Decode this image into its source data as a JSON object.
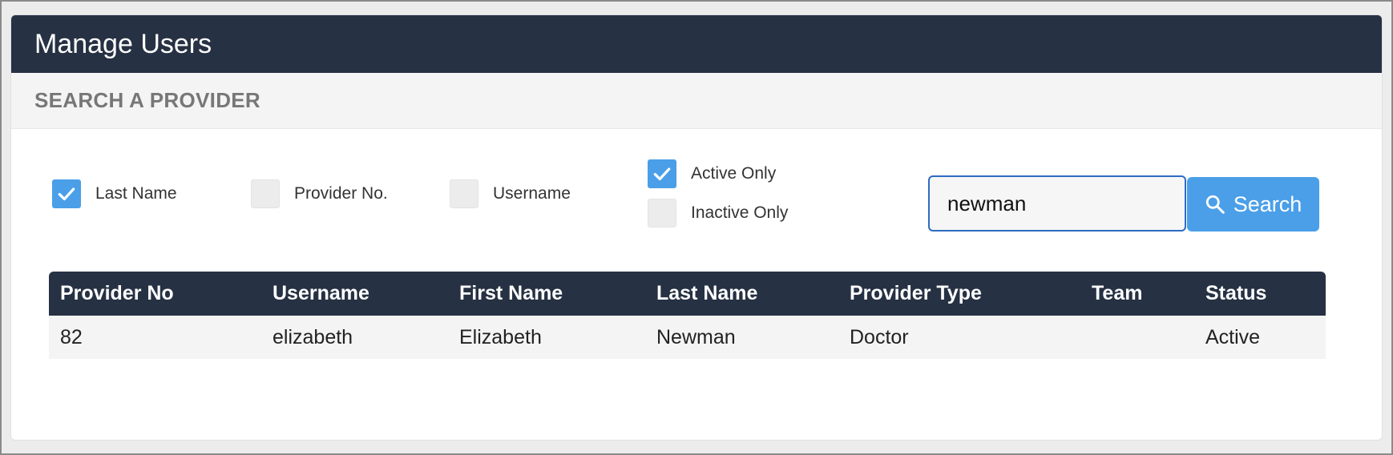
{
  "header": {
    "title": "Manage Users"
  },
  "subheader": {
    "title": "SEARCH A PROVIDER"
  },
  "filters": {
    "last_name": {
      "label": "Last Name",
      "checked": true
    },
    "provider_no": {
      "label": "Provider No.",
      "checked": false
    },
    "username": {
      "label": "Username",
      "checked": false
    },
    "active_only": {
      "label": "Active Only",
      "checked": true
    },
    "inactive_only": {
      "label": "Inactive Only",
      "checked": false
    }
  },
  "search": {
    "value": "newman",
    "button_label": "Search",
    "button_icon": "search-icon"
  },
  "table": {
    "columns": [
      "Provider No",
      "Username",
      "First Name",
      "Last Name",
      "Provider Type",
      "Team",
      "Status"
    ],
    "rows": [
      [
        "82",
        "elizabeth",
        "Elizabeth",
        "Newman",
        "Doctor",
        "",
        "Active"
      ]
    ]
  },
  "colors": {
    "header_bg": "#263143",
    "accent": "#4a9fe8",
    "input_border": "#2f6bc2",
    "row_bg": "#f4f4f4"
  }
}
